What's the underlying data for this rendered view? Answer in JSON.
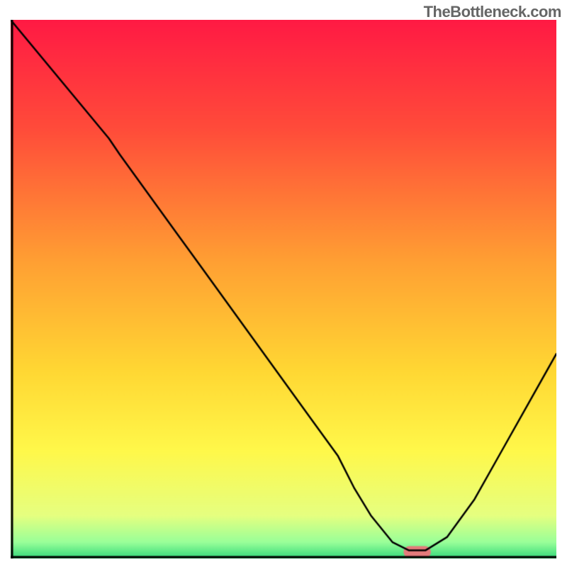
{
  "watermark": "TheBottleneck.com",
  "chart_data": {
    "type": "line",
    "title": "",
    "xlabel": "",
    "ylabel": "",
    "xlim": [
      0,
      100
    ],
    "ylim": [
      0,
      100
    ],
    "background_gradient": {
      "stops": [
        {
          "offset": 0.0,
          "color": "#ff1a44"
        },
        {
          "offset": 0.2,
          "color": "#ff4b3a"
        },
        {
          "offset": 0.45,
          "color": "#ffa033"
        },
        {
          "offset": 0.65,
          "color": "#ffd733"
        },
        {
          "offset": 0.8,
          "color": "#fff84a"
        },
        {
          "offset": 0.92,
          "color": "#e6ff80"
        },
        {
          "offset": 0.97,
          "color": "#99ff99"
        },
        {
          "offset": 1.0,
          "color": "#33d97a"
        }
      ]
    },
    "series": [
      {
        "name": "bottleneck-curve",
        "color": "#000000",
        "width": 2.5,
        "x": [
          0,
          18,
          20,
          25,
          30,
          35,
          40,
          45,
          50,
          55,
          60,
          63,
          66,
          70,
          73,
          76,
          80,
          85,
          90,
          95,
          100
        ],
        "values": [
          100,
          78,
          75,
          68,
          61,
          54,
          47,
          40,
          33,
          26,
          19,
          13,
          8,
          3,
          1.5,
          1.5,
          4,
          11,
          20,
          29,
          38
        ]
      }
    ],
    "marker": {
      "name": "optimal-range-marker",
      "color": "#e37b7b",
      "x_start": 72,
      "x_end": 77,
      "y": 1.2,
      "height": 2.2
    },
    "axes": {
      "left": {
        "visible": true,
        "color": "#000000",
        "width": 3
      },
      "bottom": {
        "visible": true,
        "color": "#000000",
        "width": 3
      },
      "ticks": "none",
      "tick_labels": "none"
    }
  }
}
